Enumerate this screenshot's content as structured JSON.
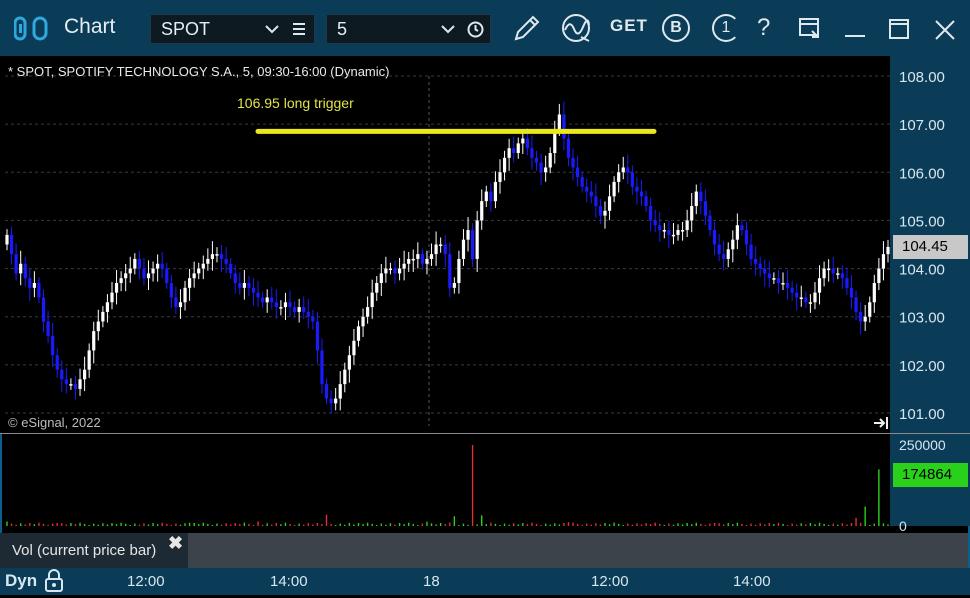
{
  "window": {
    "title": "Chart",
    "symbol": "SPOT",
    "interval": "5",
    "toolbar_icons": [
      "pencil-icon",
      "wave-icon",
      "get-icon",
      "b-icon",
      "one-icon",
      "help-icon",
      "layout-icon",
      "minimize-icon",
      "maximize-icon",
      "close-icon"
    ],
    "get_label": "GET",
    "b_label": "B",
    "one_label": "1",
    "help_label": "?"
  },
  "chart_header": "* SPOT, SPOTIFY TECHNOLOGY S.A., 5, 09:30-16:00 (Dynamic)",
  "copyright": "© eSignal, 2022",
  "annotation": {
    "text": "106.95 long trigger",
    "price": 106.85,
    "color": "#e8e81a"
  },
  "current_price_label": "104.45",
  "current_volume_label": "174864",
  "volume_panel_label": "Vol (current price bar)",
  "volume_close": "✖",
  "dyn_label": "Dyn",
  "colors": {
    "up": "#ffffff",
    "down": "#1a1aff",
    "vol_up": "#2ad11a",
    "vol_down": "#e23030",
    "grid": "#3a3a3a",
    "titlebar": "#0a3b57"
  },
  "chart_data": {
    "type": "candlestick",
    "y_ticks": [
      "108.00",
      "107.00",
      "106.00",
      "105.00",
      "104.00",
      "103.00",
      "102.00",
      "101.00"
    ],
    "ylim": [
      100.85,
      108.3
    ],
    "vol_ticks": [
      "250000",
      "0"
    ],
    "vol_max": 250000,
    "x_labels": [
      "12:00",
      "14:00",
      "18",
      "12:00",
      "14:00"
    ],
    "price_path": [
      104.7,
      104.3,
      103.9,
      104.1,
      103.8,
      103.6,
      103.7,
      103.4,
      102.9,
      102.6,
      102.2,
      101.9,
      101.7,
      101.6,
      101.6,
      101.5,
      101.7,
      101.9,
      102.3,
      102.7,
      102.9,
      103.1,
      103.3,
      103.5,
      103.7,
      103.8,
      103.9,
      104.0,
      104.2,
      104.0,
      103.8,
      103.9,
      104.0,
      104.1,
      104.0,
      103.7,
      103.4,
      103.2,
      103.3,
      103.6,
      103.8,
      103.9,
      104.0,
      104.1,
      104.2,
      104.3,
      104.3,
      104.2,
      104.1,
      103.9,
      103.7,
      103.6,
      103.7,
      103.6,
      103.5,
      103.4,
      103.3,
      103.4,
      103.3,
      103.2,
      103.2,
      103.3,
      103.2,
      103.1,
      103.2,
      103.1,
      103.0,
      102.9,
      102.3,
      101.6,
      101.3,
      101.2,
      101.3,
      101.6,
      101.9,
      102.2,
      102.5,
      102.8,
      103.0,
      103.2,
      103.5,
      103.7,
      103.9,
      104.0,
      104.0,
      103.9,
      104.0,
      104.1,
      104.2,
      104.2,
      104.3,
      104.1,
      104.2,
      104.3,
      104.5,
      104.5,
      104.3,
      103.6,
      103.7,
      104.2,
      104.6,
      104.8,
      104.2,
      105.0,
      105.4,
      105.6,
      105.4,
      105.8,
      106.0,
      106.3,
      106.5,
      106.4,
      106.6,
      106.7,
      106.5,
      106.3,
      106.2,
      106.0,
      106.1,
      106.4,
      106.9,
      107.2,
      106.7,
      106.3,
      106.1,
      105.9,
      105.7,
      105.6,
      105.5,
      105.3,
      105.1,
      105.2,
      105.5,
      105.8,
      106.0,
      106.1,
      106.0,
      105.7,
      105.6,
      105.5,
      105.3,
      105.0,
      104.9,
      104.8,
      104.8,
      104.7,
      104.7,
      104.8,
      104.8,
      105.0,
      105.3,
      105.6,
      105.4,
      105.1,
      104.8,
      104.5,
      104.3,
      104.2,
      104.4,
      104.6,
      104.9,
      104.8,
      104.5,
      104.2,
      104.1,
      104.0,
      103.9,
      103.8,
      103.8,
      103.7,
      103.7,
      103.6,
      103.5,
      103.4,
      103.4,
      103.3,
      103.3,
      103.5,
      103.8,
      104.0,
      104.0,
      103.9,
      103.9,
      103.8,
      103.6,
      103.4,
      103.1,
      102.9,
      103.0,
      103.3,
      103.7,
      104.0,
      104.3,
      104.45
    ],
    "volume_spikes": [
      {
        "index": 0,
        "value": 14000
      },
      {
        "index": 11,
        "value": 9000
      },
      {
        "index": 40,
        "value": 10000
      },
      {
        "index": 52,
        "value": 10500
      },
      {
        "index": 55,
        "value": 14000
      },
      {
        "index": 70,
        "value": 35000
      },
      {
        "index": 75,
        "value": 9500
      },
      {
        "index": 92,
        "value": 13500
      },
      {
        "index": 98,
        "value": 30000
      },
      {
        "index": 102,
        "value": 250000
      },
      {
        "index": 104,
        "value": 33000
      },
      {
        "index": 123,
        "value": 12000
      },
      {
        "index": 155,
        "value": 9500
      },
      {
        "index": 186,
        "value": 25000
      },
      {
        "index": 188,
        "value": 60000
      },
      {
        "index": 191,
        "value": 174864
      }
    ]
  }
}
